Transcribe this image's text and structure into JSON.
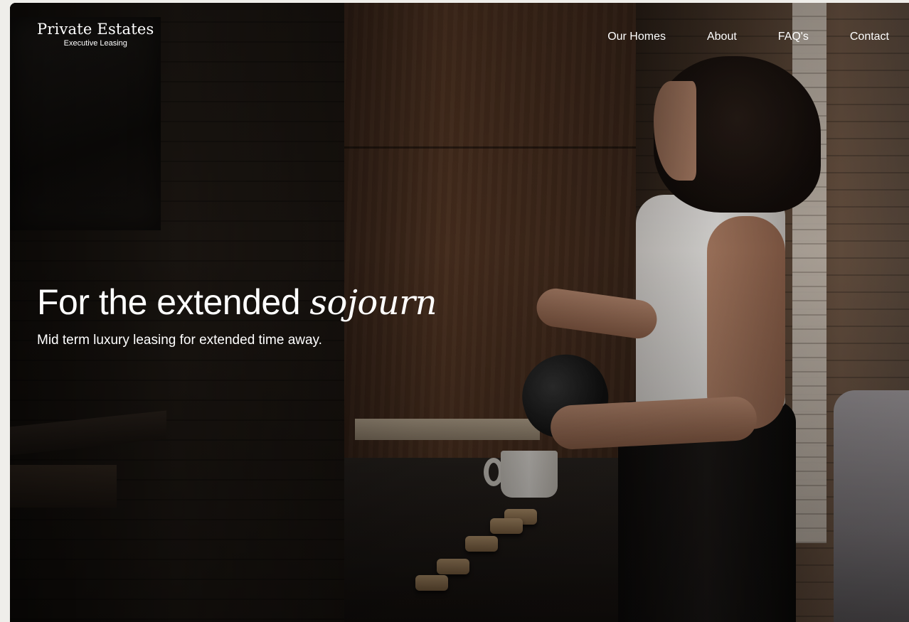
{
  "brand": {
    "name": "Private Estates",
    "tagline": "Executive Leasing"
  },
  "nav": {
    "items": [
      {
        "label": "Our Homes"
      },
      {
        "label": "About"
      },
      {
        "label": "FAQ's"
      },
      {
        "label": "Contact"
      }
    ]
  },
  "hero": {
    "title_plain": "For the extended ",
    "title_accent": "sojourn",
    "subtitle": "Mid term luxury leasing for extended time away."
  },
  "colors": {
    "text": "#ffffff",
    "page_background": "#efeeea"
  }
}
